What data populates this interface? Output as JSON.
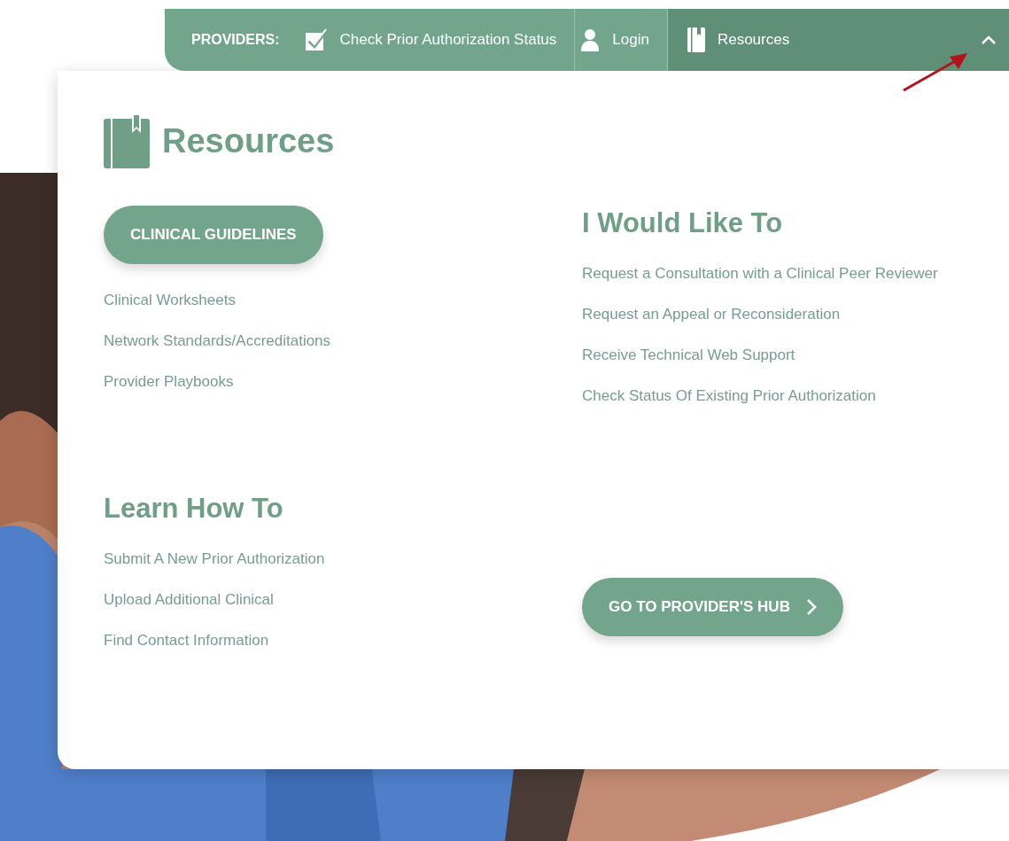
{
  "top_bar": {
    "label": "PROVIDERS:",
    "items": [
      {
        "kind": "check",
        "label": "Check Prior Authorization Status",
        "selected": false,
        "expanded": false
      },
      {
        "kind": "user",
        "label": "Login",
        "selected": false,
        "expanded": false
      },
      {
        "kind": "book",
        "label": "Resources",
        "selected": true,
        "expanded": true
      }
    ]
  },
  "panel": {
    "title": "Resources",
    "primary_button": "CLINICAL GUIDELINES",
    "links": [
      "Clinical Worksheets",
      "Network Standards/Accreditations",
      "Provider Playbooks"
    ],
    "would_like_to": {
      "title": "I Would Like To",
      "links": [
        "Request a Consultation with a Clinical Peer Reviewer",
        "Request an Appeal or Reconsideration",
        "Receive Technical Web Support",
        "Check Status Of Existing Prior Authorization"
      ]
    },
    "learn_how_to": {
      "title": "Learn How To",
      "links": [
        "Submit A New Prior Authorization",
        "Upload Additional Clinical",
        "Find Contact Information"
      ]
    },
    "hub_button": {
      "label": "GO TO PROVIDER'S HUB"
    }
  }
}
